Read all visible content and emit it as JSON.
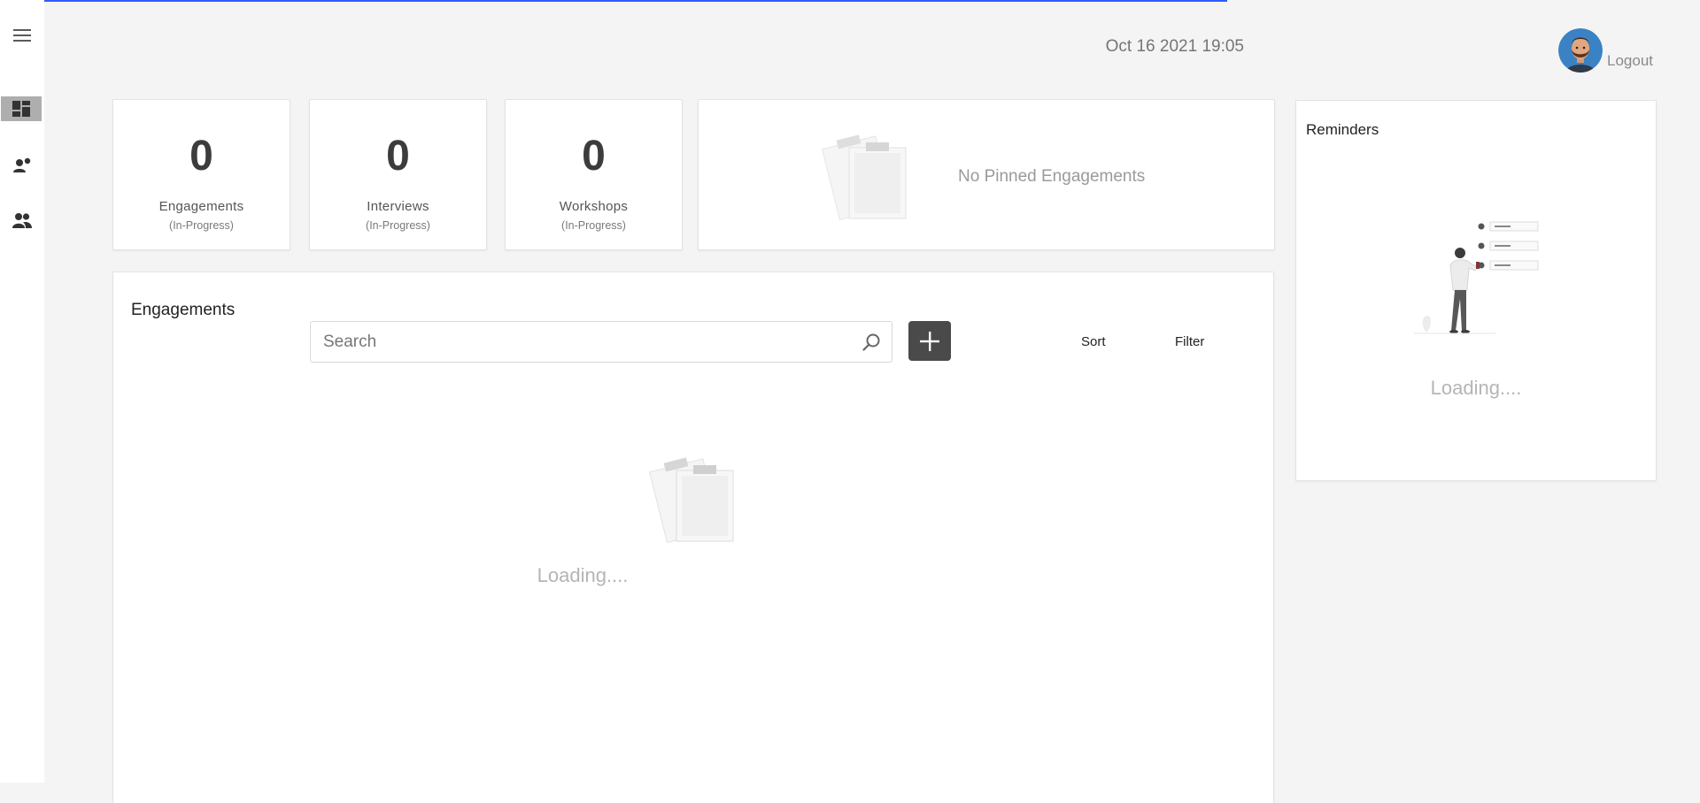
{
  "header": {
    "datetime": "Oct 16 2021  19:05",
    "logout_label": "Logout"
  },
  "sidebar": {
    "items": [
      {
        "icon": "menu-icon"
      },
      {
        "icon": "dashboard-icon",
        "active": true
      },
      {
        "icon": "interviewer-icon"
      },
      {
        "icon": "people-icon"
      }
    ]
  },
  "stats": [
    {
      "value": "0",
      "label": "Engagements",
      "sublabel": "(In-Progress)"
    },
    {
      "value": "0",
      "label": "Interviews",
      "sublabel": "(In-Progress)"
    },
    {
      "value": "0",
      "label": "Workshops",
      "sublabel": "(In-Progress)"
    }
  ],
  "pinned": {
    "empty_text": "No Pinned Engagements",
    "icon": "clipboard-icon"
  },
  "reminders": {
    "title": "Reminders",
    "loading_text": "Loading....",
    "illustration": "person-checklist-illustration"
  },
  "engagements": {
    "title": "Engagements",
    "search_placeholder": "Search",
    "add_icon": "plus-icon",
    "sort_label": "Sort",
    "filter_label": "Filter",
    "loading_text": "Loading...."
  },
  "colors": {
    "progress_bar": "#2d5bff",
    "add_button": "#4a4a4a",
    "sidebar_active": "#aeaeae",
    "background": "#f4f4f4"
  }
}
